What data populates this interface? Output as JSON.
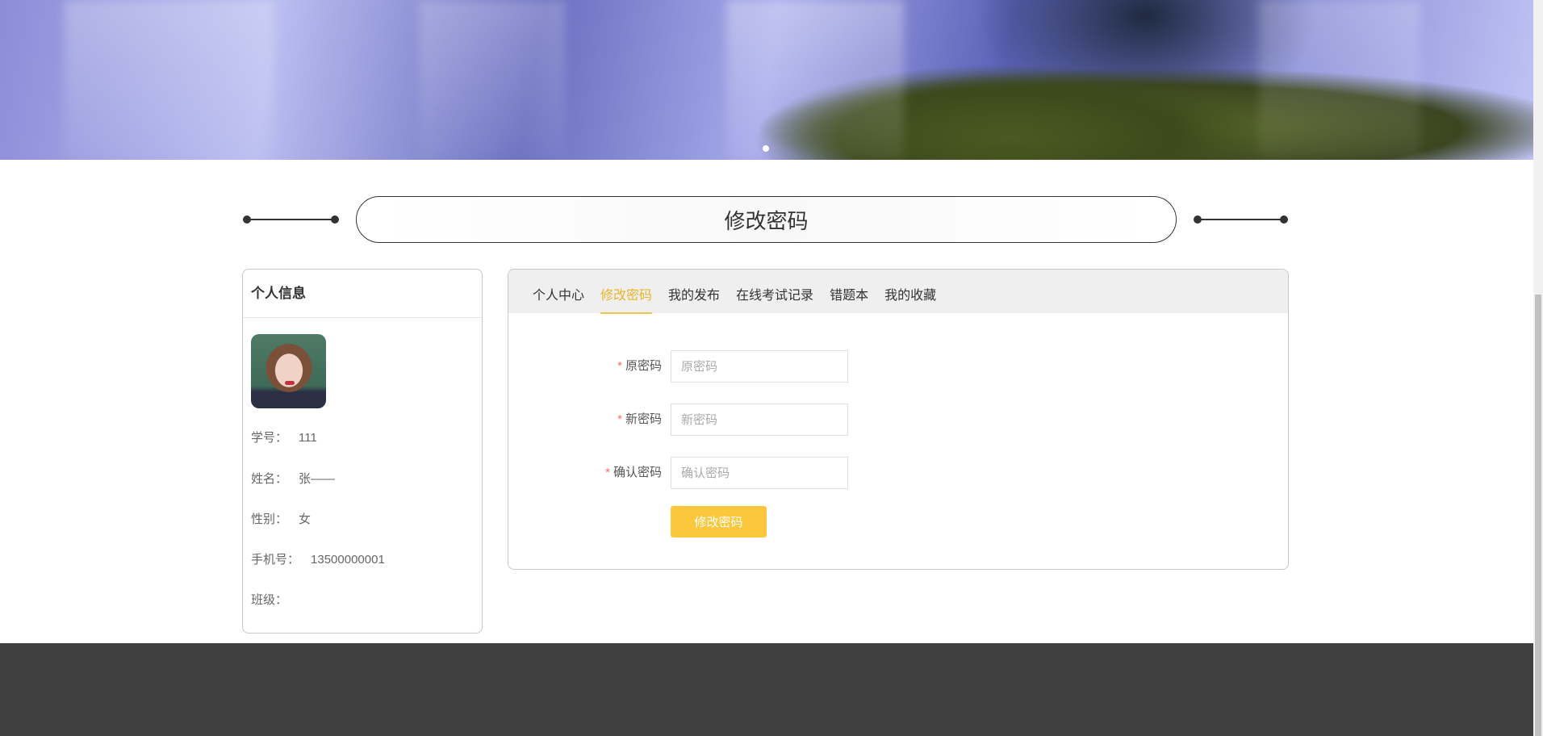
{
  "page_title": "修改密码",
  "profile": {
    "header": "个人信息",
    "fields": [
      {
        "label": "学号：",
        "value": "111"
      },
      {
        "label": "姓名：",
        "value": "张——"
      },
      {
        "label": "性别：",
        "value": "女"
      },
      {
        "label": "手机号：",
        "value": "13500000001"
      },
      {
        "label": "班级：",
        "value": ""
      }
    ]
  },
  "tabs": [
    {
      "label": "个人中心",
      "active": false
    },
    {
      "label": "修改密码",
      "active": true
    },
    {
      "label": "我的发布",
      "active": false
    },
    {
      "label": "在线考试记录",
      "active": false
    },
    {
      "label": "错题本",
      "active": false
    },
    {
      "label": "我的收藏",
      "active": false
    }
  ],
  "form": {
    "required_mark": "*",
    "old_password": {
      "label": "原密码",
      "placeholder": "原密码",
      "value": ""
    },
    "new_password": {
      "label": "新密码",
      "placeholder": "新密码",
      "value": ""
    },
    "confirm_password": {
      "label": "确认密码",
      "placeholder": "确认密码",
      "value": ""
    },
    "submit_label": "修改密码"
  },
  "colors": {
    "accent": "#fbc73c",
    "active_tab": "#e8b52a",
    "footer": "#404040"
  }
}
